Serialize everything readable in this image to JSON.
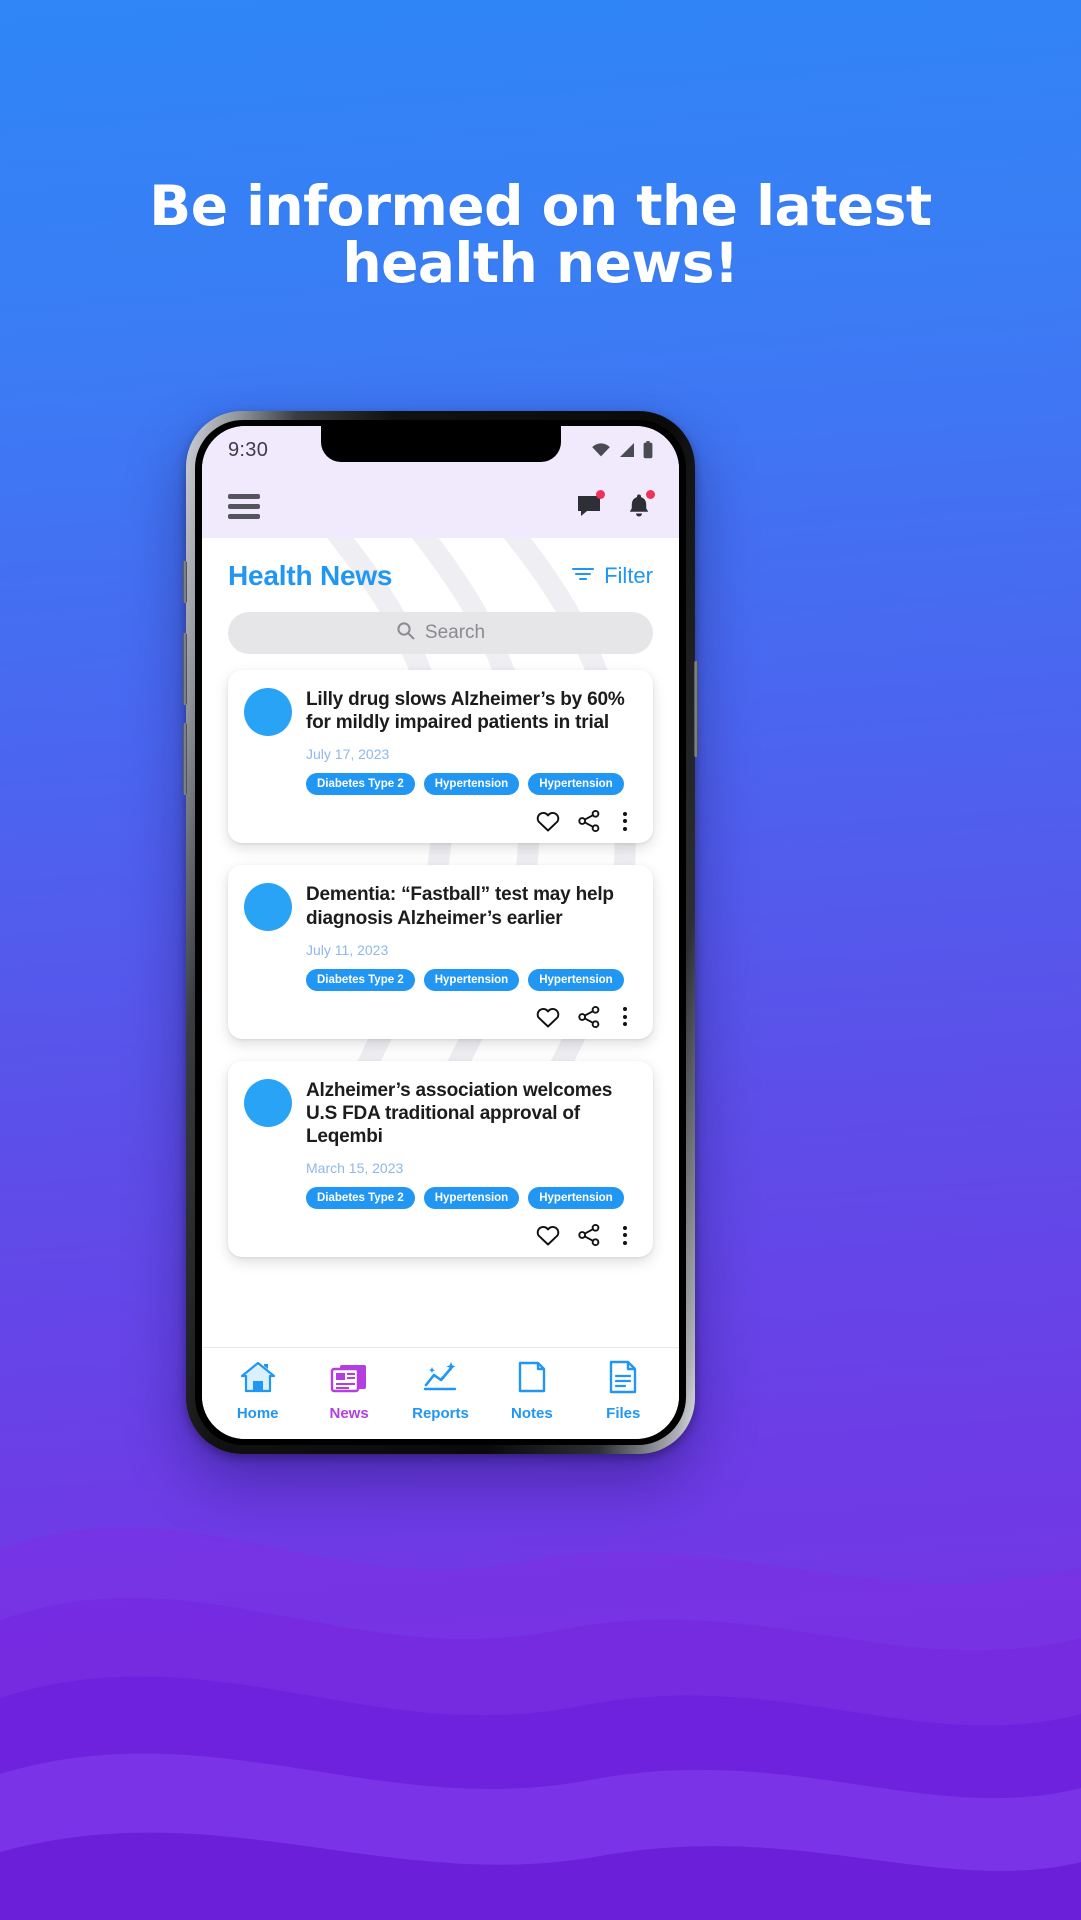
{
  "hero": {
    "line1": "Be informed on the latest",
    "line2": "health news!",
    "bg_color": "#3b7cf4",
    "bg_color_bottom": "#7a2fe3"
  },
  "phone": {
    "statusbar": {
      "time": "9:30",
      "icons": [
        "wifi-icon",
        "cellular-signal-icon",
        "battery-icon"
      ]
    },
    "appbar": {
      "menu_icon": "hamburger-menu-icon",
      "message_icon": "message-icon",
      "bell_icon": "bell-icon",
      "message_badge": true,
      "bell_badge": true
    },
    "screen": {
      "title": "Health News",
      "filter_label": "Filter",
      "filter_icon": "filter-icon",
      "search": {
        "placeholder": "Search",
        "value": "",
        "icon": "search-icon"
      },
      "accent_color": "#2196f3",
      "cards": [
        {
          "title": "Lilly drug slows Alzheimer’s by 60% for mildly impaired patients in trial",
          "date": "July 17, 2023",
          "tags": [
            "Diabetes Type 2",
            "Hypertension",
            "Hypertension"
          ],
          "actions": [
            "heart-icon",
            "share-icon",
            "more-options-icon"
          ]
        },
        {
          "title": "Dementia: “Fastball” test may help diagnosis Alzheimer’s earlier",
          "date": "July 11, 2023",
          "tags": [
            "Diabetes Type 2",
            "Hypertension",
            "Hypertension"
          ],
          "actions": [
            "heart-icon",
            "share-icon",
            "more-options-icon"
          ]
        },
        {
          "title": "Alzheimer’s association welcomes U.S FDA traditional approval of Leqembi",
          "date": "March 15, 2023",
          "tags": [
            "Diabetes Type 2",
            "Hypertension",
            "Hypertension"
          ],
          "actions": [
            "heart-icon",
            "share-icon",
            "more-options-icon"
          ]
        }
      ],
      "bottom_nav": [
        {
          "label": "Home",
          "icon": "home-icon",
          "active": false,
          "color": "#2196f3"
        },
        {
          "label": "News",
          "icon": "news-icon",
          "active": true,
          "color": "#b33fe0"
        },
        {
          "label": "Reports",
          "icon": "reports-icon",
          "active": false,
          "color": "#2196f3"
        },
        {
          "label": "Notes",
          "icon": "notes-icon",
          "active": false,
          "color": "#2196f3"
        },
        {
          "label": "Files",
          "icon": "files-icon",
          "active": false,
          "color": "#2196f3"
        }
      ]
    }
  }
}
